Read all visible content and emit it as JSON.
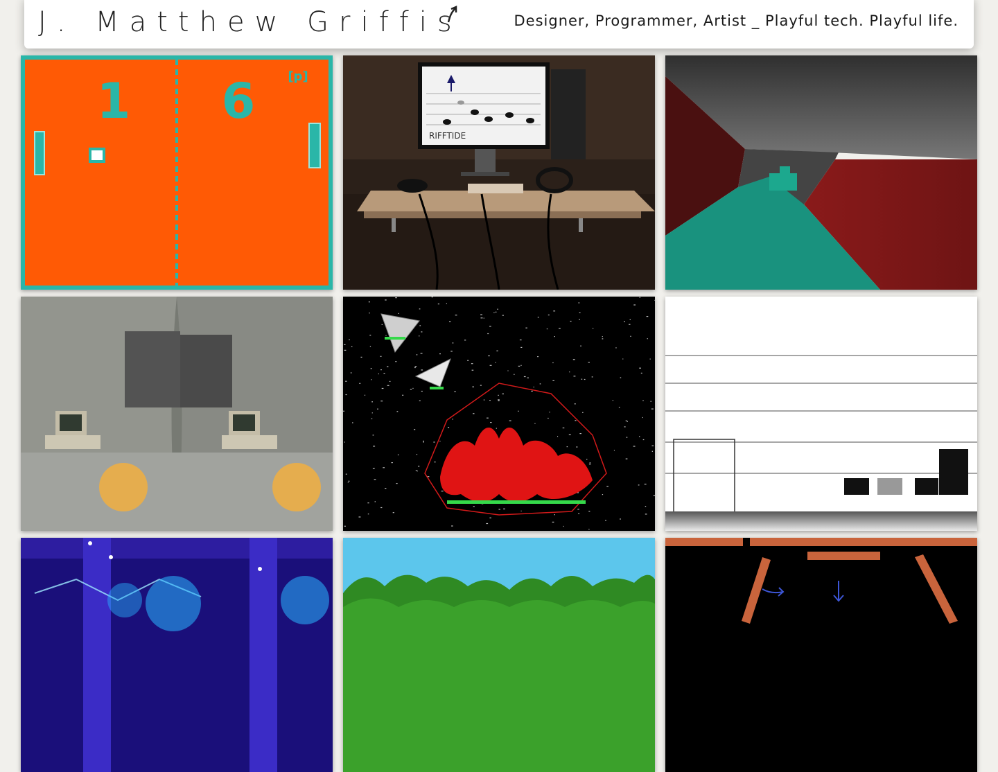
{
  "header": {
    "title": "J. Matthew Griffis",
    "tagline": "Designer, Programmer, Artist _ Playful tech. Playful life."
  },
  "gallery": {
    "items": [
      {
        "id": "pong",
        "scores": [
          "1",
          "6"
        ],
        "badge": "[p]"
      },
      {
        "id": "rifftide",
        "screen_text": "RIFFTIDE"
      },
      {
        "id": "corridor"
      },
      {
        "id": "vr-lab"
      },
      {
        "id": "space-shooter"
      },
      {
        "id": "music-blocks"
      },
      {
        "id": "blue-projection"
      },
      {
        "id": "forest"
      },
      {
        "id": "arrows-game"
      }
    ]
  },
  "colors": {
    "page_bg": "#f1f0ec",
    "pong_orange": "#ff5a05",
    "pong_teal": "#2ab6a8",
    "corridor_red": "#7a1717",
    "corridor_teal": "#19927e"
  }
}
